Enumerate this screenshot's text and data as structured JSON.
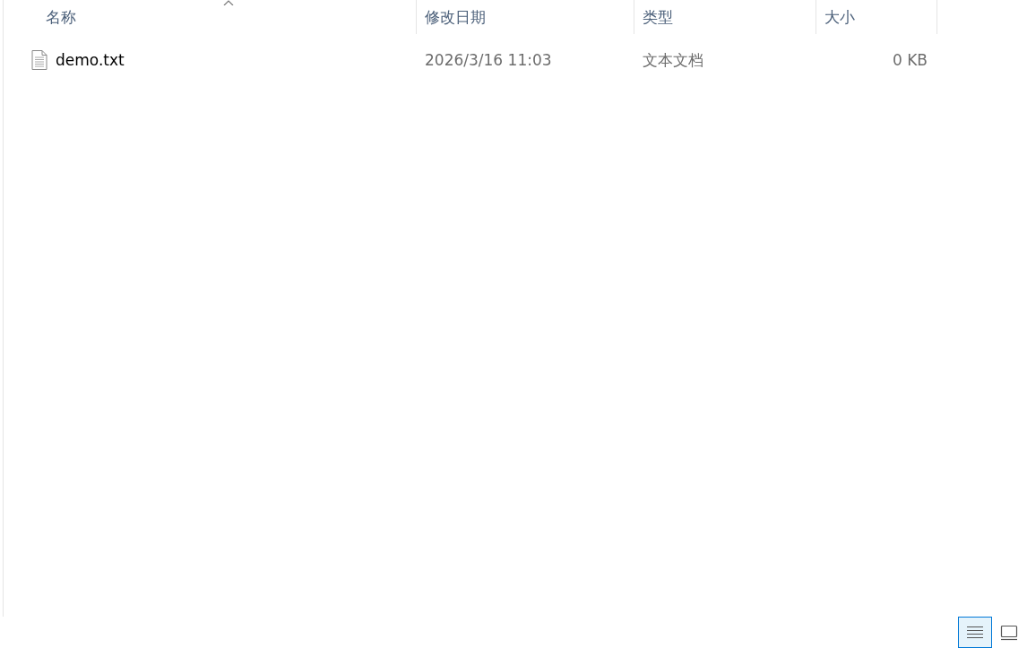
{
  "columns": [
    {
      "label": "名称",
      "sorted": true
    },
    {
      "label": "修改日期",
      "sorted": false
    },
    {
      "label": "类型",
      "sorted": false
    },
    {
      "label": "大小",
      "sorted": false
    }
  ],
  "rows": [
    {
      "cells": [
        "demo.txt",
        "2026/3/16 11:03",
        "文本文档",
        "0 KB"
      ]
    }
  ],
  "view_buttons": [
    {
      "kind": "details",
      "selected": true
    },
    {
      "kind": "large-icons",
      "selected": false
    }
  ]
}
